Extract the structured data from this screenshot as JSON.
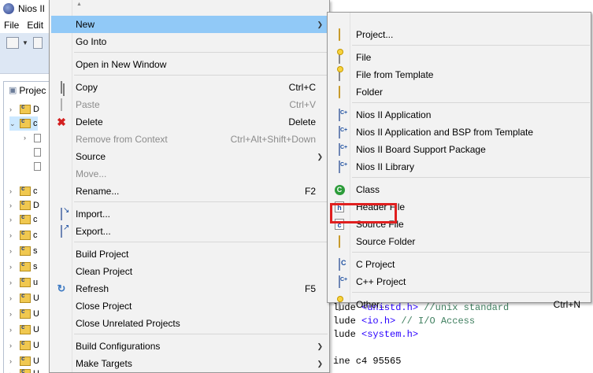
{
  "window": {
    "title": "Nios II"
  },
  "menubar": {
    "items": [
      "File",
      "Edit"
    ]
  },
  "explorer": {
    "tab_label": "Projec",
    "rows": [
      {
        "twisty": "›",
        "label": "D"
      },
      {
        "twisty": "⌄",
        "label": "c"
      },
      {
        "twisty": "›",
        "label": ""
      },
      {
        "twisty": "",
        "label": ""
      },
      {
        "twisty": "",
        "label": ""
      },
      {
        "twisty": "›",
        "label": "c"
      },
      {
        "twisty": "›",
        "label": "D"
      },
      {
        "twisty": "›",
        "label": "c"
      },
      {
        "twisty": "›",
        "label": "c"
      },
      {
        "twisty": "›",
        "label": "s"
      },
      {
        "twisty": "›",
        "label": "s"
      },
      {
        "twisty": "›",
        "label": "u"
      },
      {
        "twisty": "›",
        "label": "U"
      },
      {
        "twisty": "›",
        "label": "U"
      },
      {
        "twisty": "›",
        "label": "U"
      },
      {
        "twisty": "›",
        "label": "U"
      },
      {
        "twisty": "›",
        "label": "U"
      },
      {
        "twisty": "›",
        "label": "U"
      }
    ]
  },
  "editor": {
    "lines": [
      {
        "prefix": "lude ",
        "include": "<unistd.h>",
        "comment": " //unix standard"
      },
      {
        "prefix": "lude ",
        "include": "<io.h>",
        "comment": " // I/O Access"
      },
      {
        "prefix": "lude ",
        "include": "<system.h>",
        "comment": ""
      },
      {
        "prefix": "",
        "include": "",
        "comment": ""
      },
      {
        "prefix": "ine c4 95565",
        "include": "",
        "comment": ""
      }
    ]
  },
  "context_menu": {
    "scroll_up": "▲",
    "items": [
      {
        "label": "New",
        "shortcut": "",
        "submenu": true,
        "icon": "",
        "state": "hover"
      },
      {
        "label": "Go Into",
        "shortcut": "",
        "submenu": false,
        "icon": ""
      },
      {
        "label": "Open in New Window",
        "shortcut": "",
        "submenu": false,
        "icon": ""
      },
      {
        "label": "Copy",
        "shortcut": "Ctrl+C",
        "submenu": false,
        "icon": "copy-icon"
      },
      {
        "label": "Paste",
        "shortcut": "Ctrl+V",
        "submenu": false,
        "icon": "paste-icon",
        "state": "disabled"
      },
      {
        "label": "Delete",
        "shortcut": "Delete",
        "submenu": false,
        "icon": "delete-icon"
      },
      {
        "label": "Remove from Context",
        "shortcut": "Ctrl+Alt+Shift+Down",
        "submenu": false,
        "icon": "remove-context-icon",
        "state": "disabled"
      },
      {
        "label": "Source",
        "shortcut": "",
        "submenu": true,
        "icon": ""
      },
      {
        "label": "Move...",
        "shortcut": "",
        "submenu": false,
        "icon": "",
        "state": "disabled"
      },
      {
        "label": "Rename...",
        "shortcut": "F2",
        "submenu": false,
        "icon": ""
      },
      {
        "label": "Import...",
        "shortcut": "",
        "submenu": false,
        "icon": "import-icon"
      },
      {
        "label": "Export...",
        "shortcut": "",
        "submenu": false,
        "icon": "export-icon"
      },
      {
        "label": "Build Project",
        "shortcut": "",
        "submenu": false,
        "icon": ""
      },
      {
        "label": "Clean Project",
        "shortcut": "",
        "submenu": false,
        "icon": ""
      },
      {
        "label": "Refresh",
        "shortcut": "F5",
        "submenu": false,
        "icon": "refresh-icon"
      },
      {
        "label": "Close Project",
        "shortcut": "",
        "submenu": false,
        "icon": ""
      },
      {
        "label": "Close Unrelated Projects",
        "shortcut": "",
        "submenu": false,
        "icon": ""
      },
      {
        "label": "Build Configurations",
        "shortcut": "",
        "submenu": true,
        "icon": ""
      },
      {
        "label": "Make Targets",
        "shortcut": "",
        "submenu": true,
        "icon": ""
      }
    ]
  },
  "new_submenu": {
    "items": [
      {
        "label": "Project...",
        "shortcut": "",
        "icon": "new-project-icon"
      },
      {
        "label": "File",
        "shortcut": "",
        "icon": "file-icon"
      },
      {
        "label": "File from Template",
        "shortcut": "",
        "icon": "file-template-icon"
      },
      {
        "label": "Folder",
        "shortcut": "",
        "icon": "folder-icon"
      },
      {
        "label": "Nios II Application",
        "shortcut": "",
        "icon": "nios-application-icon"
      },
      {
        "label": "Nios II Application and BSP from Template",
        "shortcut": "",
        "icon": "nios-bsp-template-icon"
      },
      {
        "label": "Nios II Board Support Package",
        "shortcut": "",
        "icon": "nios-bsp-icon"
      },
      {
        "label": "Nios II Library",
        "shortcut": "",
        "icon": "nios-library-icon"
      },
      {
        "label": "Class",
        "shortcut": "",
        "icon": "class-icon"
      },
      {
        "label": "Header File",
        "shortcut": "",
        "icon": "header-file-icon"
      },
      {
        "label": "Source File",
        "shortcut": "",
        "icon": "source-file-icon",
        "highlighted": true
      },
      {
        "label": "Source Folder",
        "shortcut": "",
        "icon": "source-folder-icon"
      },
      {
        "label": "C Project",
        "shortcut": "",
        "icon": "c-project-icon"
      },
      {
        "label": "C++ Project",
        "shortcut": "",
        "icon": "cpp-project-icon"
      },
      {
        "label": "Other...",
        "shortcut": "Ctrl+N",
        "icon": "other-wizard-icon"
      }
    ]
  },
  "colors": {
    "menu_bg": "#f2f2f2",
    "hover": "#91c9f7",
    "highlight_box": "#e01f1f",
    "disabled_text": "#8c8c8c"
  }
}
